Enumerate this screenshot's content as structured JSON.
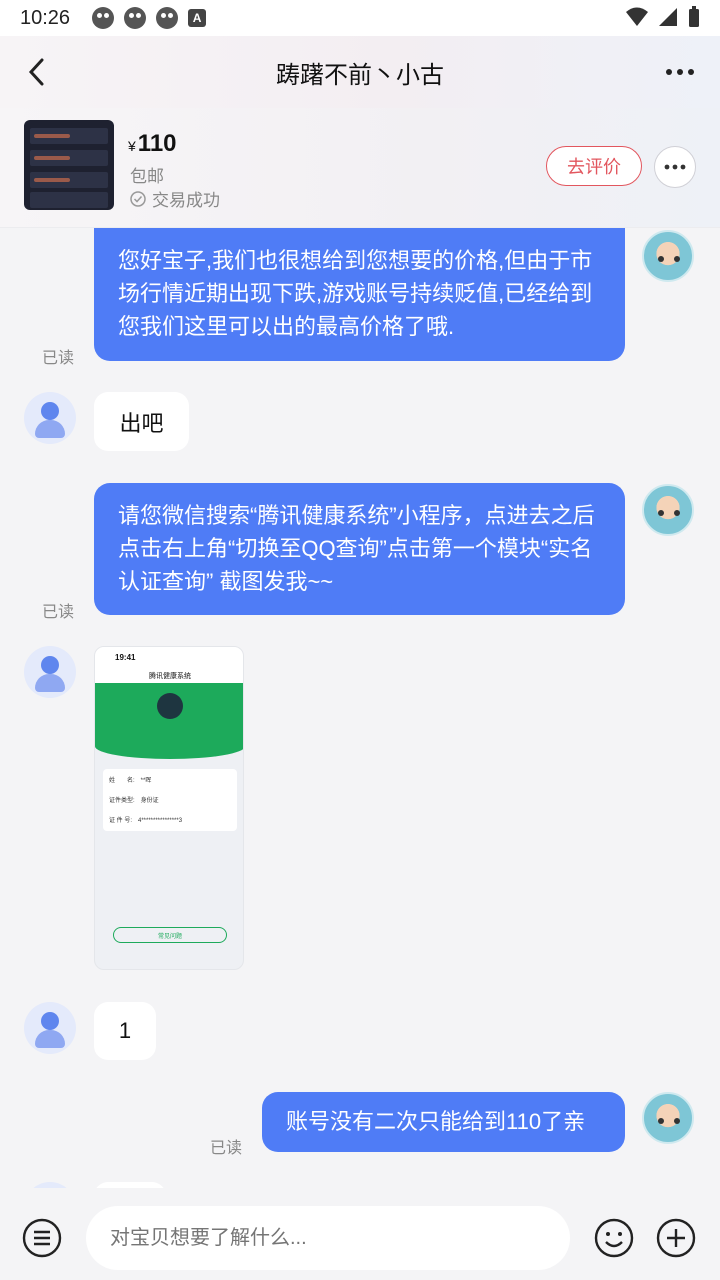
{
  "status_bar": {
    "time": "10:26"
  },
  "header": {
    "title": "踌躇不前丶小古"
  },
  "product": {
    "currency": "¥",
    "price": "110",
    "shipping": "包邮",
    "status": "交易成功",
    "review_button": "去评价"
  },
  "messages": [
    {
      "side": "me",
      "text": "您好宝子,我们也很想给到您想要的价格,但由于市场行情近期出现下跌,游戏账号持续贬值,已经给到您我们这里可以出的最高价格了哦.",
      "read": "已读"
    },
    {
      "side": "other",
      "text": "出吧"
    },
    {
      "side": "me",
      "text": "请您微信搜索“腾讯健康系统”小程序，点进去之后点击右上角“切换至QQ查询”点击第一个模块“实名认证查询” 截图发我~~",
      "read": "已读"
    },
    {
      "side": "other",
      "type": "image"
    },
    {
      "side": "other",
      "text": "1"
    },
    {
      "side": "me",
      "text": "账号没有二次只能给到110了亲",
      "read": "已读"
    }
  ],
  "screenshot": {
    "time": "19:41",
    "title": "腾讯健康系统",
    "rows": [
      "姓　　名:　**晖",
      "证件类型:　身份证",
      "证 件 号:　4****************3"
    ],
    "button": "常见问题"
  },
  "input": {
    "placeholder": "对宝贝想要了解什么..."
  }
}
